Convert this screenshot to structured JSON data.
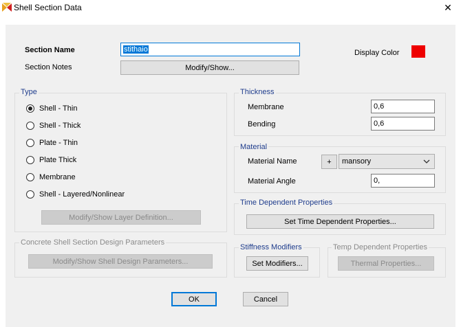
{
  "window": {
    "title": "Shell Section Data",
    "close_glyph": "✕"
  },
  "section": {
    "name_label": "Section Name",
    "name_value": "stithaio",
    "notes_label": "Section Notes",
    "notes_button": "Modify/Show...",
    "display_color_label": "Display Color",
    "display_color": "#ee0000"
  },
  "type": {
    "title": "Type",
    "options": [
      {
        "label": "Shell - Thin",
        "selected": true
      },
      {
        "label": "Shell - Thick",
        "selected": false
      },
      {
        "label": "Plate - Thin",
        "selected": false
      },
      {
        "label": "Plate Thick",
        "selected": false
      },
      {
        "label": "Membrane",
        "selected": false
      },
      {
        "label": "Shell - Layered/Nonlinear",
        "selected": false
      }
    ],
    "layer_button": "Modify/Show Layer Definition..."
  },
  "concrete": {
    "title": "Concrete Shell Section Design Parameters",
    "button": "Modify/Show Shell Design Parameters..."
  },
  "thickness": {
    "title": "Thickness",
    "membrane_label": "Membrane",
    "membrane_value": "0,6",
    "bending_label": "Bending",
    "bending_value": "0,6"
  },
  "material": {
    "title": "Material",
    "name_label": "Material Name",
    "plus_button": "+",
    "name_value": "mansory",
    "angle_label": "Material Angle",
    "angle_value": "0,"
  },
  "time_dependent": {
    "title": "Time Dependent Properties",
    "button": "Set Time Dependent Properties..."
  },
  "stiffness": {
    "title": "Stiffness Modifiers",
    "button": "Set Modifiers..."
  },
  "temp": {
    "title": "Temp Dependent Properties",
    "button": "Thermal Properties..."
  },
  "footer": {
    "ok": "OK",
    "cancel": "Cancel"
  }
}
